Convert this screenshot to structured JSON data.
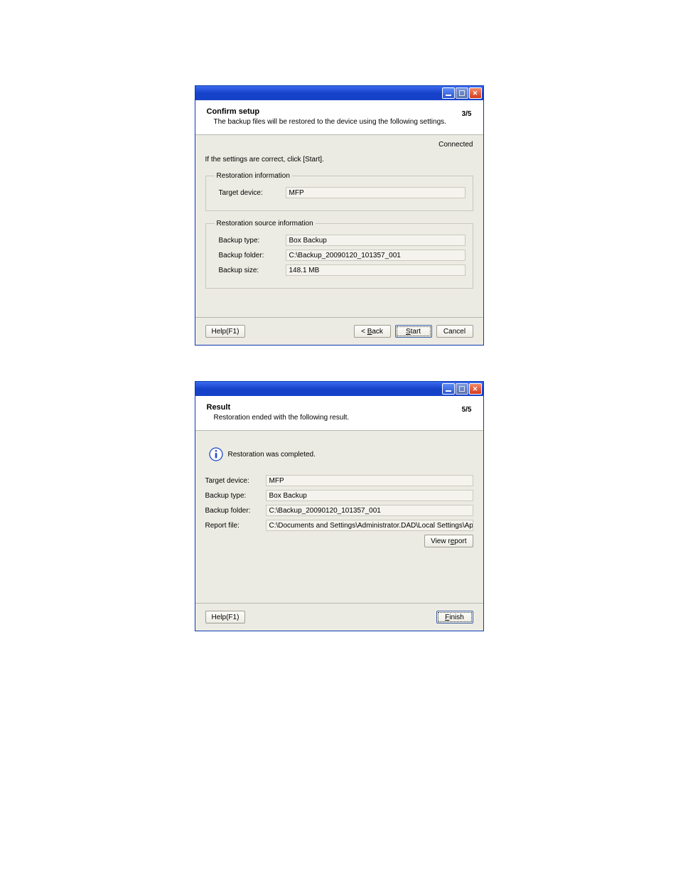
{
  "win1": {
    "title": "Confirm setup",
    "subtitle": "The backup files will be restored to the device using the following settings.",
    "step": "3/5",
    "status": "Connected",
    "instruction": "If the settings are correct, click [Start].",
    "restoration_info": {
      "legend": "Restoration information",
      "target_device_label": "Target device:",
      "target_device_value": "MFP"
    },
    "source_info": {
      "legend": "Restoration source information",
      "backup_type_label": "Backup type:",
      "backup_type_value": "Box Backup",
      "backup_folder_label": "Backup folder:",
      "backup_folder_value": "C:\\Backup_20090120_101357_001",
      "backup_size_label": "Backup size:",
      "backup_size_value": "148.1 MB"
    },
    "buttons": {
      "help": "Help(F1)",
      "back": "< Back",
      "start": "Start",
      "cancel": "Cancel"
    }
  },
  "win2": {
    "title": "Result",
    "subtitle": "Restoration ended with the following result.",
    "step": "5/5",
    "info_text": "Restoration was completed.",
    "fields": {
      "target_device_label": "Target device:",
      "target_device_value": "MFP",
      "backup_type_label": "Backup type:",
      "backup_type_value": "Box Backup",
      "backup_folder_label": "Backup folder:",
      "backup_folder_value": "C:\\Backup_20090120_101357_001",
      "report_file_label": "Report file:",
      "report_file_value": "C:\\Documents and Settings\\Administrator.DAD\\Local Settings\\Application Data\\KON"
    },
    "buttons": {
      "view_report": "View report",
      "help": "Help(F1)",
      "finish": "Finish"
    }
  }
}
